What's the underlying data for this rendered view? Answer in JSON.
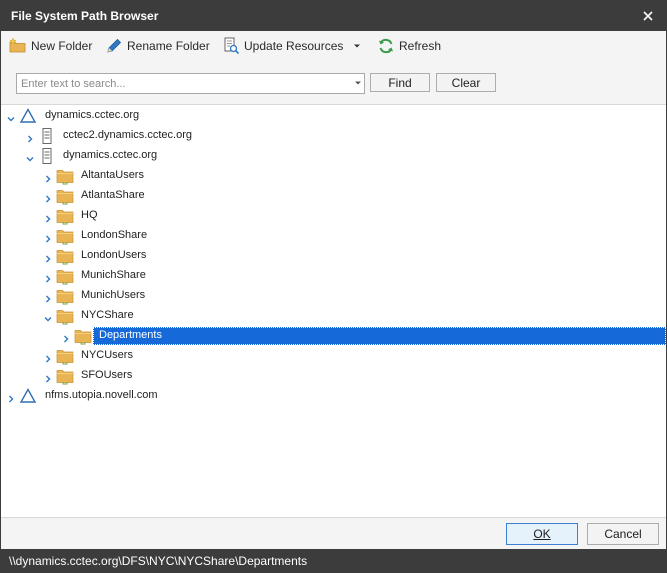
{
  "window": {
    "title": "File System Path Browser"
  },
  "toolbar": {
    "new_folder": "New Folder",
    "rename_folder": "Rename Folder",
    "update_resources": "Update Resources",
    "refresh": "Refresh"
  },
  "search": {
    "placeholder": "Enter text to search...",
    "value": "",
    "find_label": "Find",
    "clear_label": "Clear"
  },
  "tree": [
    {
      "label": "dynamics.cctec.org",
      "type": "domain",
      "level": 0,
      "expanded": true
    },
    {
      "label": "cctec2.dynamics.cctec.org",
      "type": "server",
      "level": 1,
      "expanded": false
    },
    {
      "label": "dynamics.cctec.org",
      "type": "server",
      "level": 1,
      "expanded": true
    },
    {
      "label": "AltantaUsers",
      "type": "folder",
      "level": 2,
      "expanded": false
    },
    {
      "label": "AtlantaShare",
      "type": "folder",
      "level": 2,
      "expanded": false
    },
    {
      "label": "HQ",
      "type": "folder",
      "level": 2,
      "expanded": false
    },
    {
      "label": "LondonShare",
      "type": "folder",
      "level": 2,
      "expanded": false
    },
    {
      "label": "LondonUsers",
      "type": "folder",
      "level": 2,
      "expanded": false
    },
    {
      "label": "MunichShare",
      "type": "folder",
      "level": 2,
      "expanded": false
    },
    {
      "label": "MunichUsers",
      "type": "folder",
      "level": 2,
      "expanded": false
    },
    {
      "label": "NYCShare",
      "type": "folder",
      "level": 2,
      "expanded": true
    },
    {
      "label": "Departments",
      "type": "folder",
      "level": 3,
      "expanded": false,
      "selected": true
    },
    {
      "label": "NYCUsers",
      "type": "folder",
      "level": 2,
      "expanded": false
    },
    {
      "label": "SFOUsers",
      "type": "folder",
      "level": 2,
      "expanded": false
    },
    {
      "label": "nfms.utopia.novell.com",
      "type": "domain",
      "level": 0,
      "expanded": false
    }
  ],
  "footer": {
    "ok_label": "OK",
    "cancel_label": "Cancel"
  },
  "status": {
    "path": "\\\\dynamics.cctec.org\\DFS\\NYC\\NYCShare\\Departments"
  },
  "colors": {
    "titlebar": "#3c3c3c",
    "selection": "#1569d8",
    "accent_blue": "#2f78c4",
    "folder": "#e8b454"
  }
}
